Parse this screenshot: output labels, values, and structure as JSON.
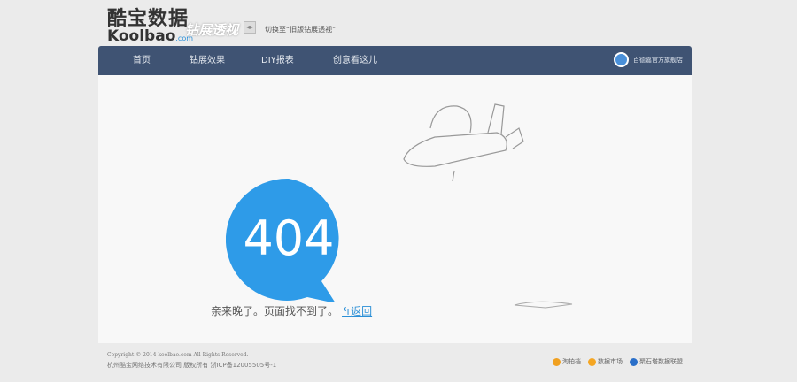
{
  "brand": {
    "name_cn": "酷宝数据",
    "name_en": "Koolbao",
    "domain": ".com",
    "product": "钻展透视"
  },
  "switch": {
    "label": "切换至“旧版钻展透视”"
  },
  "nav": {
    "items": [
      "首页",
      "钻展效果",
      "DIY报表",
      "创意看这儿"
    ],
    "shop": "百德嘉官方旗舰店"
  },
  "error": {
    "code": "404",
    "message": "亲来晚了。页面找不到了。",
    "back": "返回",
    "color": "#2e9be8"
  },
  "footer": {
    "copyright": "Copyright © 2014 koolbao.com All Rights Reserved.",
    "company": "杭州酷宝网络技术有限公司 版权所有 浙ICP备12005505号-1",
    "links": [
      "淘拍档",
      "数据市场",
      "聚石塔数据联盟"
    ]
  }
}
